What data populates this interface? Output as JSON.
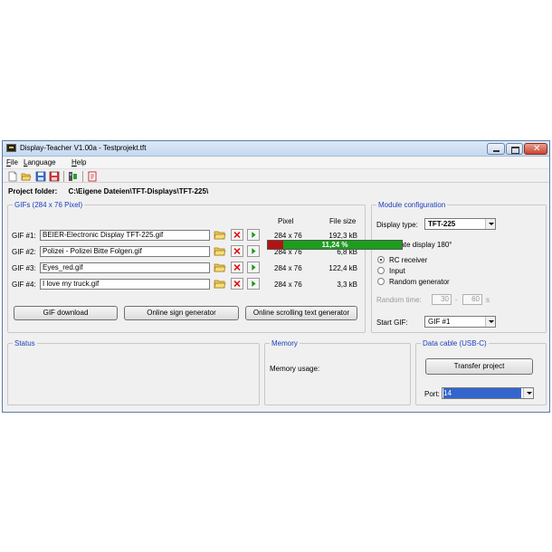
{
  "window": {
    "title": "Display-Teacher V1.00a - Testprojekt.tft"
  },
  "menu": [
    "File",
    "Language",
    "Help"
  ],
  "toolbar": {
    "icons": [
      "new-file-icon",
      "open-folder-icon",
      "save-icon",
      "save-as-icon",
      "settings-icon",
      "help-book-icon"
    ]
  },
  "project": {
    "label": "Project folder:",
    "path": "C:\\Eigene Dateien\\TFT-Displays\\TFT-225\\"
  },
  "gifs": {
    "legend": "GIFs (284 x 76 Pixel)",
    "col_pixel": "Pixel",
    "col_filesize": "File size",
    "rows": [
      {
        "label": "GIF #1:",
        "file": "BEIER-Electronic Display TFT-225.gif",
        "pixel": "284 x 76",
        "size": "192,3 kB"
      },
      {
        "label": "GIF #2:",
        "file": "Polizei - Polizei Bitte Folgen.gif",
        "pixel": "284 x 76",
        "size": "6,8 kB"
      },
      {
        "label": "GIF #3:",
        "file": "Eyes_red.gif",
        "pixel": "284 x 76",
        "size": "122,4 kB"
      },
      {
        "label": "GIF #4:",
        "file": "I love my truck.gif",
        "pixel": "284 x 76",
        "size": "3,3 kB"
      }
    ],
    "btn_download": "GIF download",
    "btn_sign": "Online sign generator",
    "btn_scroll": "Online scrolling text generator"
  },
  "module": {
    "legend": "Module configuration",
    "display_type_label": "Display type:",
    "display_type_value": "TFT-225",
    "rotate_label": "Rotate display 180°",
    "radio_rc": "RC receiver",
    "radio_input": "Input",
    "radio_random": "Random generator",
    "random_time_label": "Random time:",
    "random_from": "30",
    "random_dash": "-",
    "random_to": "60",
    "random_unit": "s",
    "start_gif_label": "Start GIF:",
    "start_gif_value": "GIF #1"
  },
  "status": {
    "legend": "Status"
  },
  "memory": {
    "legend": "Memory",
    "usage_label": "Memory usage:",
    "percent_text": "11,24 %",
    "percent_value": 11.24
  },
  "datacable": {
    "legend": "Data cable (USB-C)",
    "btn_transfer": "Transfer project",
    "port_label": "Port:",
    "port_value": "14"
  },
  "colors": {
    "legend_blue": "#1c3fbd",
    "memory_used": "#b31212",
    "memory_free": "#1c9e1c",
    "port_highlight": "#3366cc"
  }
}
